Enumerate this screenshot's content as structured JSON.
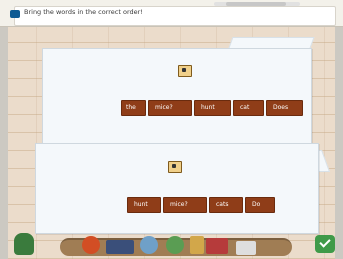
{
  "header": {
    "instruction": "Bring the words in the correct order!"
  },
  "puzzles": [
    {
      "words": [
        "the",
        "mice?",
        "hunt",
        "cat",
        "Does"
      ]
    },
    {
      "words": [
        "hunt",
        "mice?",
        "cats",
        "Do"
      ]
    }
  ],
  "icons": {
    "flag": "flag-icon",
    "audio": "speaker-icon",
    "check": "check-icon"
  },
  "colors": {
    "word_tile": "#8f3d18",
    "check": "#3f9a49"
  }
}
